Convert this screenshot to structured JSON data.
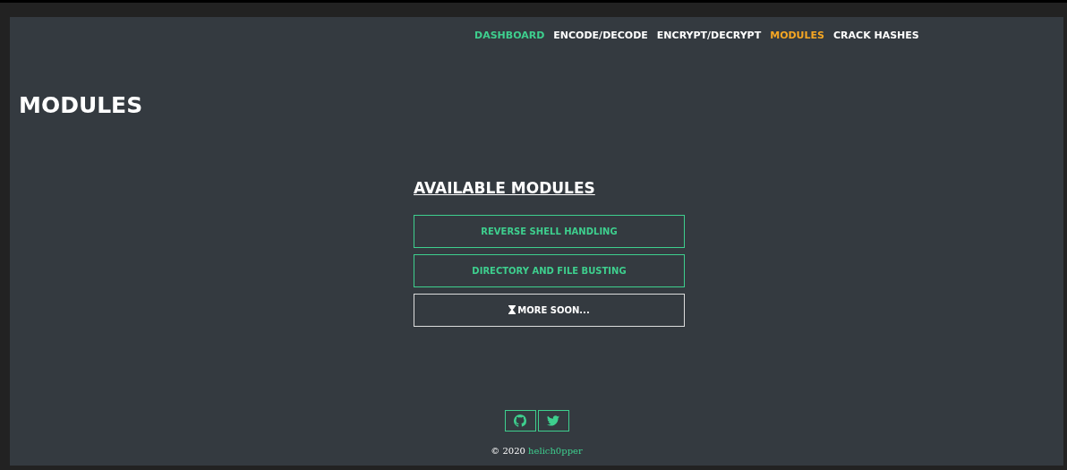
{
  "nav": [
    {
      "label": "DASHBOARD",
      "color": "#3ecf8e"
    },
    {
      "label": "ENCODE/DECODE",
      "color": "#ffffff"
    },
    {
      "label": "ENCRYPT/DECRYPT",
      "color": "#ffffff"
    },
    {
      "label": "MODULES",
      "color": "#f5a623"
    },
    {
      "label": "CRACK HASHES",
      "color": "#ffffff"
    }
  ],
  "page_title": "MODULES",
  "section_title": "AVAILABLE MODULES",
  "modules": [
    {
      "label": "REVERSE SHELL HANDLING",
      "kind": "module"
    },
    {
      "label": "DIRECTORY AND FILE BUSTING",
      "kind": "module"
    },
    {
      "label": "MORE SOON...",
      "kind": "upcoming"
    }
  ],
  "footer": {
    "social": [
      {
        "kind": "github"
      },
      {
        "kind": "twitter"
      }
    ],
    "copyright": "© 2020",
    "author": "helich0pper"
  }
}
